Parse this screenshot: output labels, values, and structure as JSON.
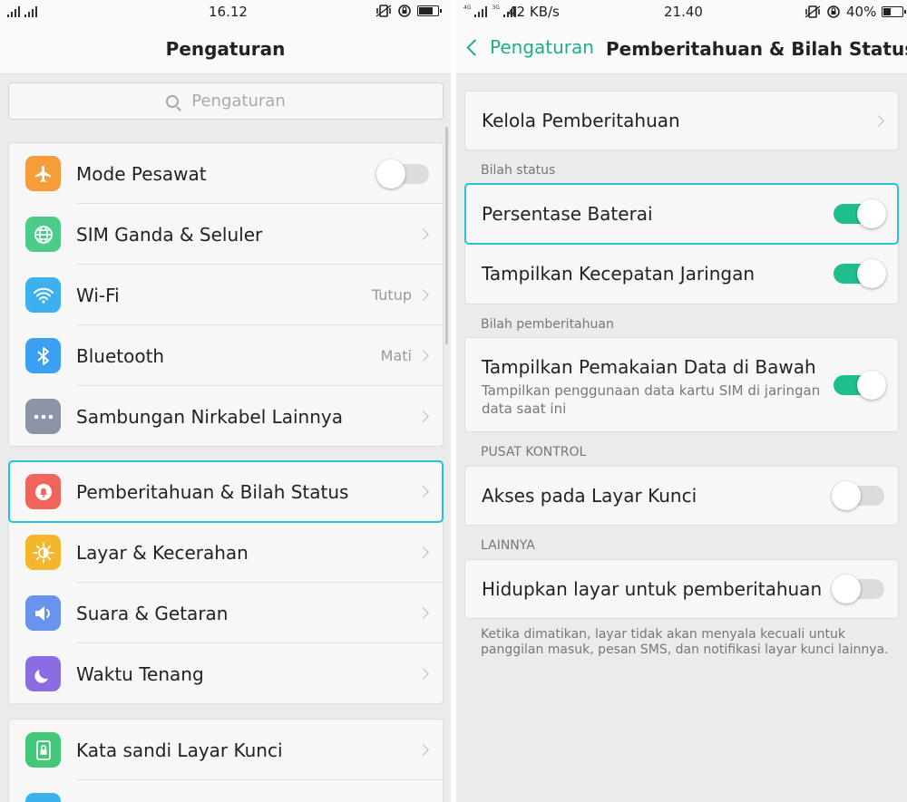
{
  "left": {
    "status": {
      "time": "16.12",
      "battery_level": 0.8
    },
    "title": "Pengaturan",
    "search_placeholder": "Pengaturan",
    "items": [
      {
        "label": "Mode Pesawat",
        "icon": "airplane-icon",
        "color": "#f59c3b",
        "control": "toggle-off"
      },
      {
        "label": "SIM Ganda & Seluler",
        "icon": "globe-icon",
        "color": "#4dcb8b",
        "control": "arrow"
      },
      {
        "label": "Wi-Fi",
        "icon": "wifi-icon",
        "color": "#3cb1ee",
        "value": "Tutup",
        "control": "arrow"
      },
      {
        "label": "Bluetooth",
        "icon": "bluetooth-icon",
        "color": "#3b9ff2",
        "value": "Mati",
        "control": "arrow"
      },
      {
        "label": "Sambungan Nirkabel Lainnya",
        "icon": "more-icon",
        "color": "#8c95a8",
        "control": "arrow"
      },
      {
        "label": "Pemberitahuan & Bilah Status",
        "icon": "notification-icon",
        "color": "#f0655a",
        "control": "arrow",
        "selected": true
      },
      {
        "label": "Layar &  Kecerahan",
        "icon": "brightness-icon",
        "color": "#f3b62c",
        "control": "arrow"
      },
      {
        "label": "Suara & Getaran",
        "icon": "speaker-icon",
        "color": "#6a93ee",
        "control": "arrow"
      },
      {
        "label": "Waktu Tenang",
        "icon": "moon-icon",
        "color": "#8b6de3",
        "control": "arrow"
      },
      {
        "label": "Kata sandi Layar Kunci",
        "icon": "lock-icon",
        "color": "#43c778",
        "control": "arrow"
      }
    ]
  },
  "right": {
    "status": {
      "speed": "42 KB/s",
      "time": "21.40",
      "battery": "40%"
    },
    "back_label": "Pengaturan",
    "title": "Pemberitahuan & Bilah Status",
    "manage_notifications": "Kelola Pemberitahuan",
    "section_status_bar": "Bilah status",
    "battery_percentage": {
      "label": "Persentase Baterai",
      "on": true
    },
    "network_speed": {
      "label": "Tampilkan Kecepatan Jaringan",
      "on": true
    },
    "section_notification_bar": "Bilah pemberitahuan",
    "data_usage": {
      "label": "Tampilkan Pemakaian Data di Bawah",
      "desc": "Tampilkan penggunaan data kartu SIM di jaringan data saat ini",
      "on": true
    },
    "section_control_center": "PUSAT KONTROL",
    "lock_screen_access": {
      "label": "Akses pada Layar Kunci",
      "on": false
    },
    "section_others": "LAINNYA",
    "wake_screen": {
      "label": "Hidupkan layar untuk pemberitahuan",
      "on": false
    },
    "note": "Ketika dimatikan, layar tidak akan menyala kecuali untuk panggilan masuk, pesan SMS, dan notifikasi layar kunci lainnya."
  }
}
